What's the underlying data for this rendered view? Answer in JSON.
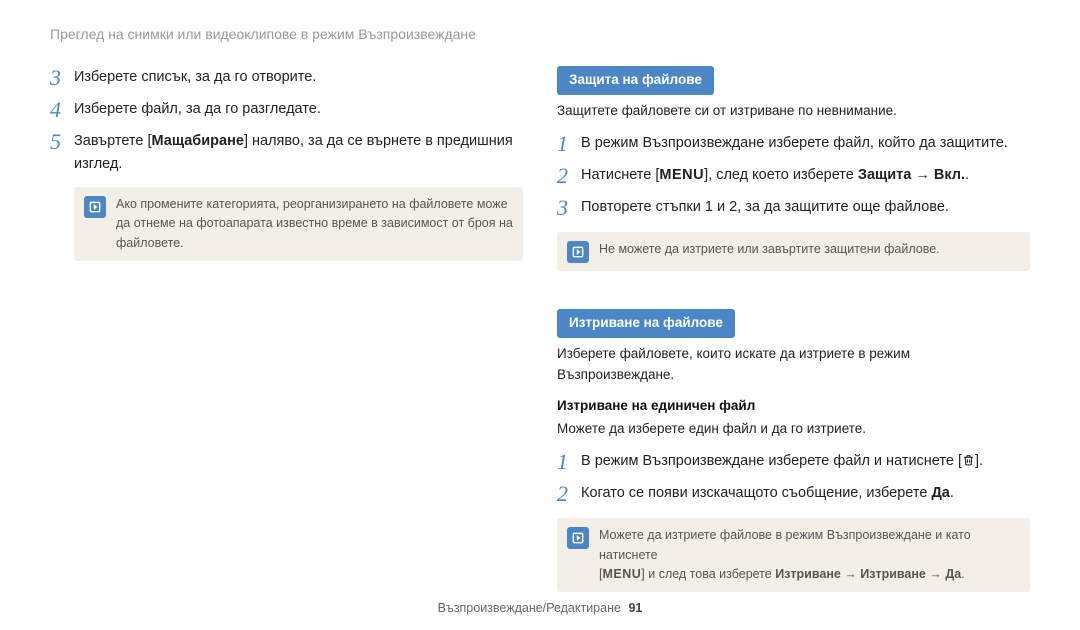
{
  "header": "Преглед на снимки или видеоклипове в режим Възпроизвеждане",
  "left": {
    "steps": [
      {
        "seq": "3",
        "text": "Изберете списък, за да го отворите."
      },
      {
        "seq": "4",
        "text": "Изберете файл, за да го разгледате."
      },
      {
        "seq": "5",
        "pre": "Завъртете [",
        "bold": "Мащабиране",
        "post": "] наляво, за да се върнете в предишния изглед."
      }
    ],
    "note": "Ако промените категорията, реорганизирането на файловете може да отнеме на фотоапарата известно време в зависимост от броя на файловете."
  },
  "right": {
    "sectionA": {
      "title": "Защита на файлове",
      "intro": "Защитете файловете си от изтриване по невнимание.",
      "steps": [
        {
          "seq": "1",
          "text": "В режим Възпроизвеждане изберете файл, който да защитите."
        },
        {
          "seq": "2",
          "pre": "Натиснете [",
          "menu": true,
          "mid": "], след което изберете ",
          "bold": "Защита → Вкл.",
          "post": "."
        },
        {
          "seq": "3",
          "text": "Повторете стъпки 1 и 2, за да защитите още файлове."
        }
      ],
      "note": "Не можете да изтриете или завъртите защитени файлове."
    },
    "sectionB": {
      "title": "Изтриване на файлове",
      "intro": "Изберете файловете, които искате да изтриете в режим Възпроизвеждане.",
      "subheading": "Изтриване на единичен файл",
      "subtext": "Можете да изберете един файл и да го изтриете.",
      "steps": [
        {
          "seq": "1",
          "pre": "В режим Възпроизвеждане изберете файл и натиснете [",
          "trash": true,
          "post": "]."
        },
        {
          "seq": "2",
          "pre": "Когато се появи изскачащото съобщение, изберете ",
          "bold": "Да",
          "post": "."
        }
      ],
      "note_line1": "Можете да изтриете файлове в режим Възпроизвеждане и като натиснете",
      "note_line2_pre": "[",
      "note_line2_menu": true,
      "note_line2_mid": "] и след това изберете ",
      "note_line2_bold": "Изтриване → Изтриване → Да",
      "note_line2_post": "."
    }
  },
  "footer": {
    "text": "Възпроизвеждане/Редактиране",
    "page": "91"
  }
}
